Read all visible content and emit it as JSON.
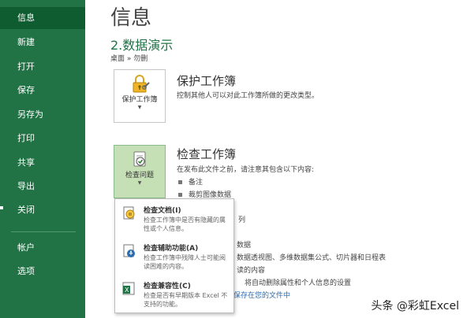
{
  "sidebar": {
    "items": [
      {
        "label": "信息",
        "active": true
      },
      {
        "label": "新建"
      },
      {
        "label": "打开"
      },
      {
        "label": "保存"
      },
      {
        "label": "另存为"
      },
      {
        "label": "打印"
      },
      {
        "label": "共享"
      },
      {
        "label": "导出"
      },
      {
        "label": "关闭"
      },
      {
        "label": "帐户"
      },
      {
        "label": "选项"
      }
    ]
  },
  "main": {
    "title": "信息",
    "file_name": "2.数据演示",
    "file_path": "桌面 » 勿删",
    "protect": {
      "button_label": "保护工作簿",
      "title": "保护工作簿",
      "desc": "控制其他人可以对此工作簿所做的更改类型。"
    },
    "inspect": {
      "button_label": "检查问题",
      "title": "检查工作簿",
      "desc": "在发布此文件之前，请注意其包含以下内容:",
      "bullets": [
        "备注",
        "裁剪图像数据"
      ]
    },
    "fragments": [
      "列",
      "数据",
      "数据透视图、多维数据集公式、切片器和日程表",
      "读的内容",
      "将自动删除属性和个人信息的设置",
      "保存在您的文件中"
    ]
  },
  "menu": {
    "items": [
      {
        "title": "检查文档(I)",
        "desc": "检查工作簿中是否有隐藏的属性或个人信息。"
      },
      {
        "title": "检查辅助功能(A)",
        "desc": "检查工作簿中残障人士可能阅读困难的内容。"
      },
      {
        "title": "检查兼容性(C)",
        "desc": "检查是否有早期版本 Excel 不支持的功能。"
      }
    ]
  },
  "watermark": "头条 @彩虹Excel",
  "colors": {
    "sidebar": "#217346",
    "sidebar_active": "#0e5c2f",
    "accent_green": "#217346",
    "button_active": "#c5e0b4"
  }
}
